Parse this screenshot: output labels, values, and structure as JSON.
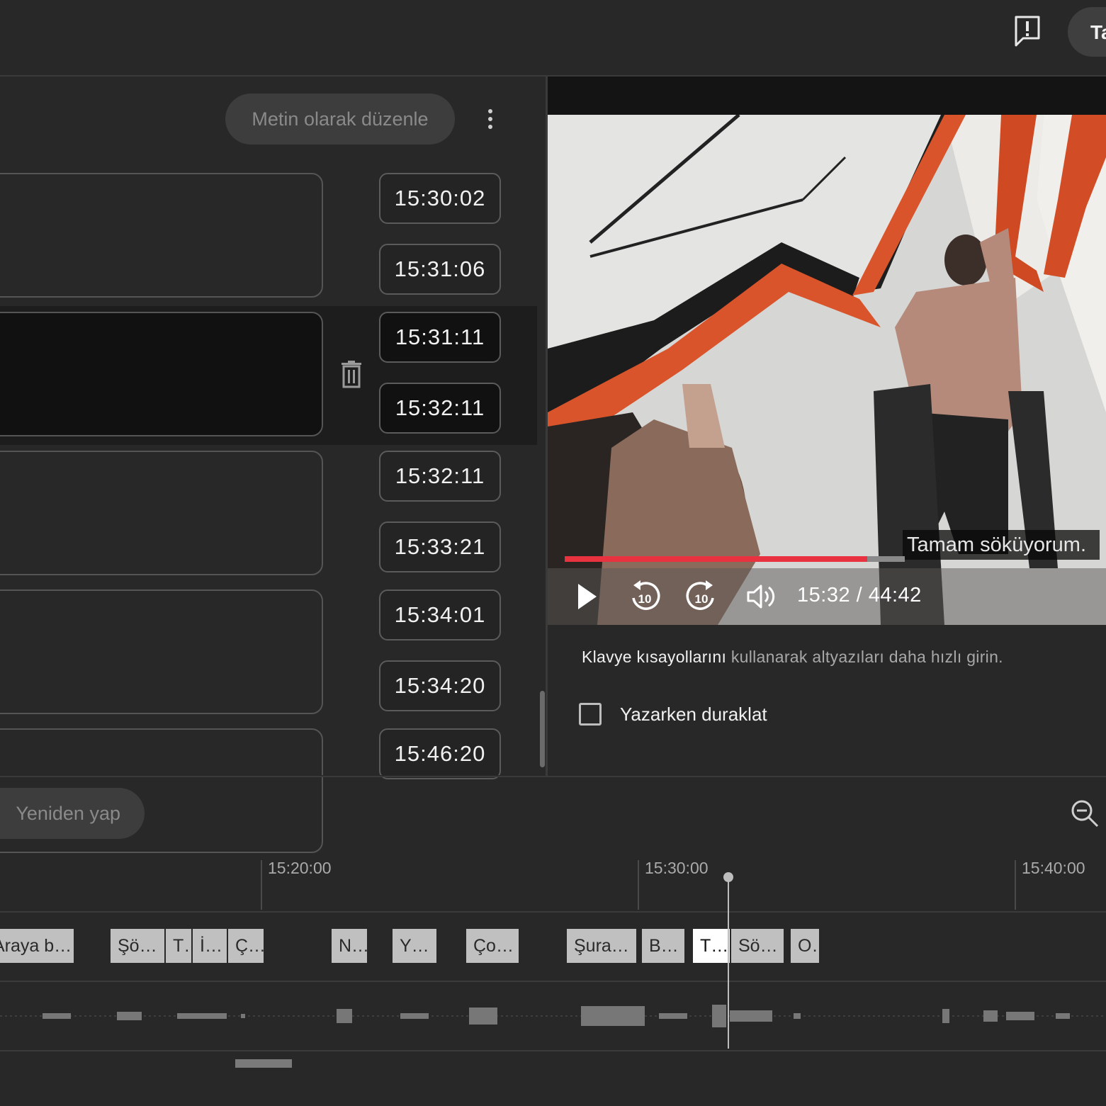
{
  "header": {
    "feedback_icon": "feedback-exclamation-icon",
    "action_button_label": "Ta"
  },
  "editor": {
    "edit_as_text_label": "Metin olarak düzenle",
    "more_icon": "vertical-dots-icon",
    "trash_icon": "trash-icon",
    "rows": [
      {
        "start": "15:30:02",
        "end": "15:31:06",
        "text": "",
        "active": false
      },
      {
        "start": "15:31:11",
        "end": "15:32:11",
        "text": "",
        "active": true
      },
      {
        "start": "15:32:11",
        "end": "15:33:21",
        "text": "",
        "active": false
      },
      {
        "start": "15:34:01",
        "end": "15:34:20",
        "text": "",
        "active": false
      },
      {
        "start": "15:46:20",
        "end": "",
        "text": "",
        "active": false
      }
    ]
  },
  "player": {
    "caption": "Tamam söküyorum.",
    "current_time": "15:32",
    "duration": "44:42",
    "time_display": "15:32 / 44:42",
    "progress_fraction": 0.89,
    "progress_color": "#e8323f",
    "icons": [
      "play-icon",
      "rewind-10-icon",
      "forward-10-icon",
      "volume-icon"
    ],
    "rewind_label": "10",
    "forward_label": "10"
  },
  "options": {
    "shortcut_link": "Klavye kısayollarını",
    "shortcut_rest": " kullanarak altyazıları daha hızlı girin.",
    "pause_while_typing_label": "Yazarken duraklat",
    "pause_while_typing_checked": false
  },
  "timeline": {
    "redo_label": "Yeniden yap",
    "zoom_icon": "zoom-out-icon",
    "ticks": [
      "15:20:00",
      "15:30:00",
      "15:40:00"
    ],
    "chips": [
      {
        "label": "Araya b…",
        "active": false
      },
      {
        "label": "Şö…",
        "active": false
      },
      {
        "label": "T…",
        "active": false
      },
      {
        "label": "İ…",
        "active": false
      },
      {
        "label": "Ç…",
        "active": false
      },
      {
        "label": "N…",
        "active": false
      },
      {
        "label": "Y…",
        "active": false
      },
      {
        "label": "Ço…",
        "active": false
      },
      {
        "label": "Şura…",
        "active": false
      },
      {
        "label": "B…",
        "active": false
      },
      {
        "label": "T…",
        "active": true
      },
      {
        "label": "Sö…",
        "active": false
      },
      {
        "label": "O…",
        "active": false
      }
    ]
  }
}
